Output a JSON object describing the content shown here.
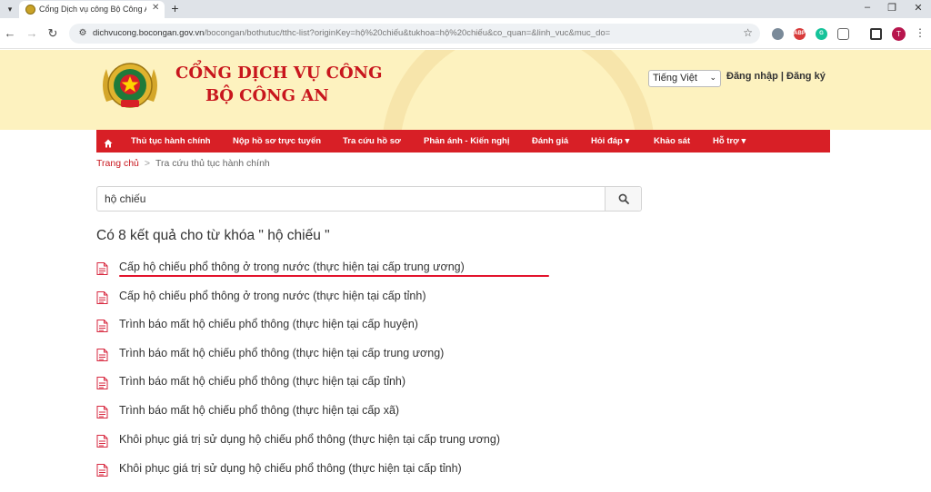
{
  "browser": {
    "tab_title": "Cổng Dịch vụ công Bộ Công An",
    "url_host": "dichvucong.bocongan.gov.vn",
    "url_path": "/bocongan/bothutuc/tthc-list?originKey=hộ%20chiếu&tukhoa=hộ%20chiếu&co_quan=&linh_vuc&muc_do=",
    "profile_initial": "T"
  },
  "header": {
    "brand_line1": "CỔNG DỊCH VỤ CÔNG",
    "brand_line2": "BỘ CÔNG AN",
    "language": "Tiếng Việt",
    "auth": "Đăng nhập | Đăng ký"
  },
  "nav": {
    "items": [
      "Thủ tục hành chính",
      "Nộp hồ sơ trực tuyến",
      "Tra cứu hồ sơ",
      "Phản ánh - Kiến nghị",
      "Đánh giá",
      "Hỏi đáp ▾",
      "Khảo sát",
      "Hỗ trợ ▾"
    ]
  },
  "breadcrumb": {
    "home": "Trang chủ",
    "separator": ">",
    "current": "Tra cứu thủ tục hành chính"
  },
  "search": {
    "value": "hộ chiếu"
  },
  "results_heading": "Có 8 kết quả cho từ khóa \" hộ chiếu \"",
  "results": [
    "Cấp hộ chiếu phổ thông ở trong nước (thực hiện tại cấp trung ương)",
    "Cấp hộ chiếu phổ thông ở trong nước (thực hiện tại cấp tỉnh)",
    "Trình báo mất hộ chiếu phổ thông (thực hiện tại cấp huyện)",
    "Trình báo mất hộ chiếu phổ thông (thực hiện tại cấp trung ương)",
    "Trình báo mất hộ chiếu phổ thông (thực hiện tại cấp tỉnh)",
    "Trình báo mất hộ chiếu phổ thông (thực hiện tại cấp xã)",
    "Khôi phục giá trị sử dụng hộ chiếu phổ thông (thực hiện tại cấp trung ương)",
    "Khôi phục giá trị sử dụng hộ chiếu phổ thông (thực hiện tại cấp tỉnh)"
  ],
  "colors": {
    "brand_red": "#c8161d",
    "nav_red": "#d81f26",
    "header_bg": "#fdf2bf",
    "annotation_underline": "#e3142d"
  }
}
